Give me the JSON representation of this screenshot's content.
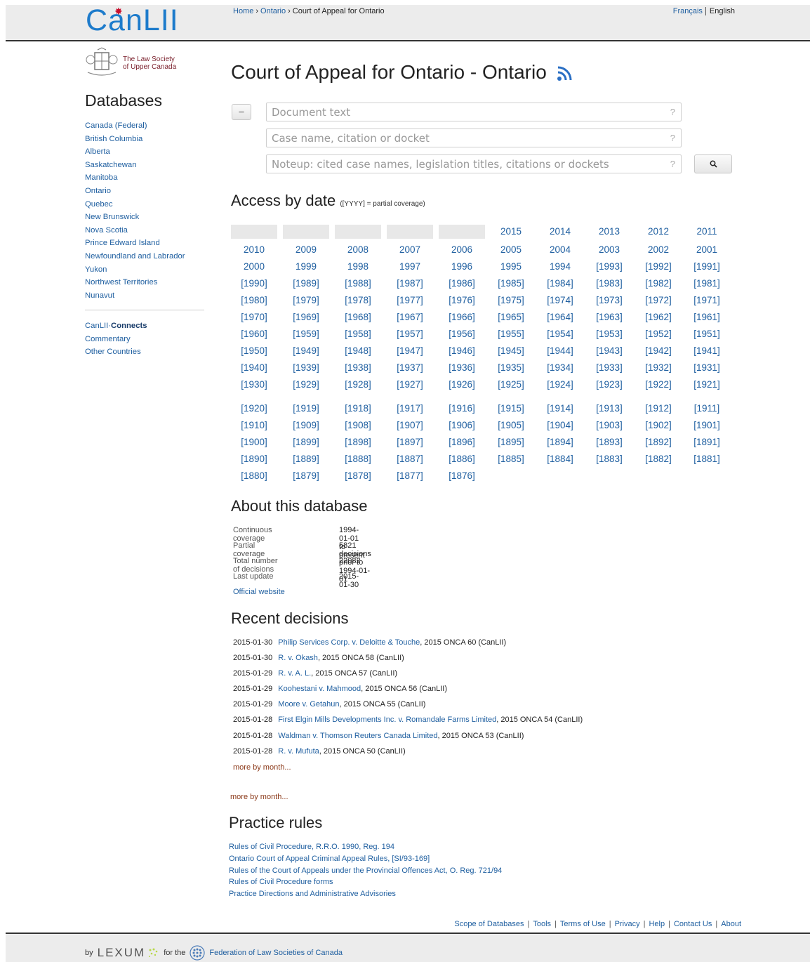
{
  "header": {
    "logo": "CanLII",
    "breadcrumb": [
      {
        "label": "Home",
        "link": true
      },
      {
        "label": "Ontario",
        "link": true
      },
      {
        "label": "Court of Appeal for Ontario",
        "link": false
      }
    ],
    "breadcrumb_sep": "›",
    "lang_fr": "Français",
    "lang_en": "English"
  },
  "sidebar": {
    "lsuc_line1": "The Law Society",
    "lsuc_line2": "of Upper Canada",
    "title": "Databases",
    "items": [
      "Canada (Federal)",
      "British Columbia",
      "Alberta",
      "Saskatchewan",
      "Manitoba",
      "Ontario",
      "Quebec",
      "New Brunswick",
      "Nova Scotia",
      "Prince Edward Island",
      "Newfoundland and Labrador",
      "Yukon",
      "Northwest Territories",
      "Nunavut"
    ],
    "connects_prefix": "CanLII·",
    "connects_bold": "Connects",
    "extra": [
      "Commentary",
      "Other Countries"
    ]
  },
  "main": {
    "title": "Court of Appeal for Ontario - Ontario",
    "toggle_label": "–",
    "search": {
      "document_text": "Document text",
      "case_name": "Case name, citation or docket",
      "noteup": "Noteup: cited case names, legislation titles, citations or dockets",
      "help": "?"
    },
    "access_title": "Access by date",
    "access_note": "([YYYY] = partial coverage)",
    "year_rows": [
      [
        "",
        "",
        "",
        "",
        "",
        "2015",
        "2014",
        "2013",
        "2012",
        "2011"
      ],
      [
        "2010",
        "2009",
        "2008",
        "2007",
        "2006",
        "2005",
        "2004",
        "2003",
        "2002",
        "2001"
      ],
      [
        "2000",
        "1999",
        "1998",
        "1997",
        "1996",
        "1995",
        "1994",
        "[1993]",
        "[1992]",
        "[1991]"
      ],
      [
        "[1990]",
        "[1989]",
        "[1988]",
        "[1987]",
        "[1986]",
        "[1985]",
        "[1984]",
        "[1983]",
        "[1982]",
        "[1981]"
      ],
      [
        "[1980]",
        "[1979]",
        "[1978]",
        "[1977]",
        "[1976]",
        "[1975]",
        "[1974]",
        "[1973]",
        "[1972]",
        "[1971]"
      ],
      [
        "[1970]",
        "[1969]",
        "[1968]",
        "[1967]",
        "[1966]",
        "[1965]",
        "[1964]",
        "[1963]",
        "[1962]",
        "[1961]"
      ],
      [
        "[1960]",
        "[1959]",
        "[1958]",
        "[1957]",
        "[1956]",
        "[1955]",
        "[1954]",
        "[1953]",
        "[1952]",
        "[1951]"
      ],
      [
        "[1950]",
        "[1949]",
        "[1948]",
        "[1947]",
        "[1946]",
        "[1945]",
        "[1944]",
        "[1943]",
        "[1942]",
        "[1941]"
      ],
      [
        "[1940]",
        "[1939]",
        "[1938]",
        "[1937]",
        "[1936]",
        "[1935]",
        "[1934]",
        "[1933]",
        "[1932]",
        "[1931]"
      ],
      [
        "[1930]",
        "[1929]",
        "[1928]",
        "[1927]",
        "[1926]",
        "[1925]",
        "[1924]",
        "[1923]",
        "[1922]",
        "[1921]"
      ],
      [
        "[1920]",
        "[1919]",
        "[1918]",
        "[1917]",
        "[1916]",
        "[1915]",
        "[1914]",
        "[1913]",
        "[1912]",
        "[1911]"
      ],
      [
        "[1910]",
        "[1909]",
        "[1908]",
        "[1907]",
        "[1906]",
        "[1905]",
        "[1904]",
        "[1903]",
        "[1902]",
        "[1901]"
      ],
      [
        "[1900]",
        "[1899]",
        "[1898]",
        "[1897]",
        "[1896]",
        "[1895]",
        "[1894]",
        "[1893]",
        "[1892]",
        "[1891]"
      ],
      [
        "[1890]",
        "[1889]",
        "[1888]",
        "[1887]",
        "[1886]",
        "[1885]",
        "[1884]",
        "[1883]",
        "[1882]",
        "[1881]"
      ],
      [
        "[1880]",
        "[1879]",
        "[1878]",
        "[1877]",
        "[1876]"
      ]
    ],
    "about_title": "About this database",
    "about": [
      {
        "k": "Continuous coverage",
        "v": "1994-01-01 to present"
      },
      {
        "k": "Partial coverage",
        "v": "5821 decisions prior to 1994-01-01"
      },
      {
        "k": "Total number of decisions",
        "v": "22082"
      },
      {
        "k": "Last update",
        "v": "2015-01-30"
      }
    ],
    "official_website": "Official website",
    "recent_title": "Recent decisions",
    "recent": [
      {
        "date": "2015-01-30",
        "name": "Philip Services Corp. v. Deloitte & Touche",
        "cite": ", 2015 ONCA 60 (CanLII)"
      },
      {
        "date": "2015-01-30",
        "name": "R. v. Okash",
        "cite": ", 2015 ONCA 58 (CanLII)"
      },
      {
        "date": "2015-01-29",
        "name": "R. v. A. L.",
        "cite": ", 2015 ONCA 57 (CanLII)"
      },
      {
        "date": "2015-01-29",
        "name": "Koohestani v. Mahmood",
        "cite": ", 2015 ONCA 56 (CanLII)"
      },
      {
        "date": "2015-01-29",
        "name": "Moore v. Getahun",
        "cite": ", 2015 ONCA 55 (CanLII)"
      },
      {
        "date": "2015-01-28",
        "name": "First Elgin Mills Developments Inc. v. Romandale Farms Limited",
        "cite": ", 2015 ONCA 54 (CanLII)"
      },
      {
        "date": "2015-01-28",
        "name": "Waldman v. Thomson Reuters Canada Limited",
        "cite": ", 2015 ONCA 53 (CanLII)"
      },
      {
        "date": "2015-01-28",
        "name": "R. v. Mufuta",
        "cite": ", 2015 ONCA 50 (CanLII)"
      }
    ],
    "more_by_month": "more by month...",
    "practice_title": "Practice rules",
    "practice": [
      "Rules of Civil Procedure, R.R.O. 1990, Reg. 194",
      "Ontario Court of Appeal Criminal Appeal Rules, [SI/93-169]",
      "Rules of the Court of Appeals under the Provincial Offences Act, O. Reg. 721/94",
      "Rules of Civil Procedure forms",
      "Practice Directions and Administrative Advisories"
    ]
  },
  "footer": {
    "links": [
      "Scope of Databases",
      "Tools",
      "Terms of Use",
      "Privacy",
      "Help",
      "Contact Us",
      "About"
    ],
    "by": "by",
    "lexum": "LEXUM",
    "for_the": "for the",
    "federation": "Federation of Law Societies of Canada"
  },
  "colors": {
    "link": "#1f5fa0",
    "brand": "#1d7bcb",
    "maple": "#c8102e",
    "rss": "#2a6fc4",
    "more_link": "#8b3a1a"
  }
}
